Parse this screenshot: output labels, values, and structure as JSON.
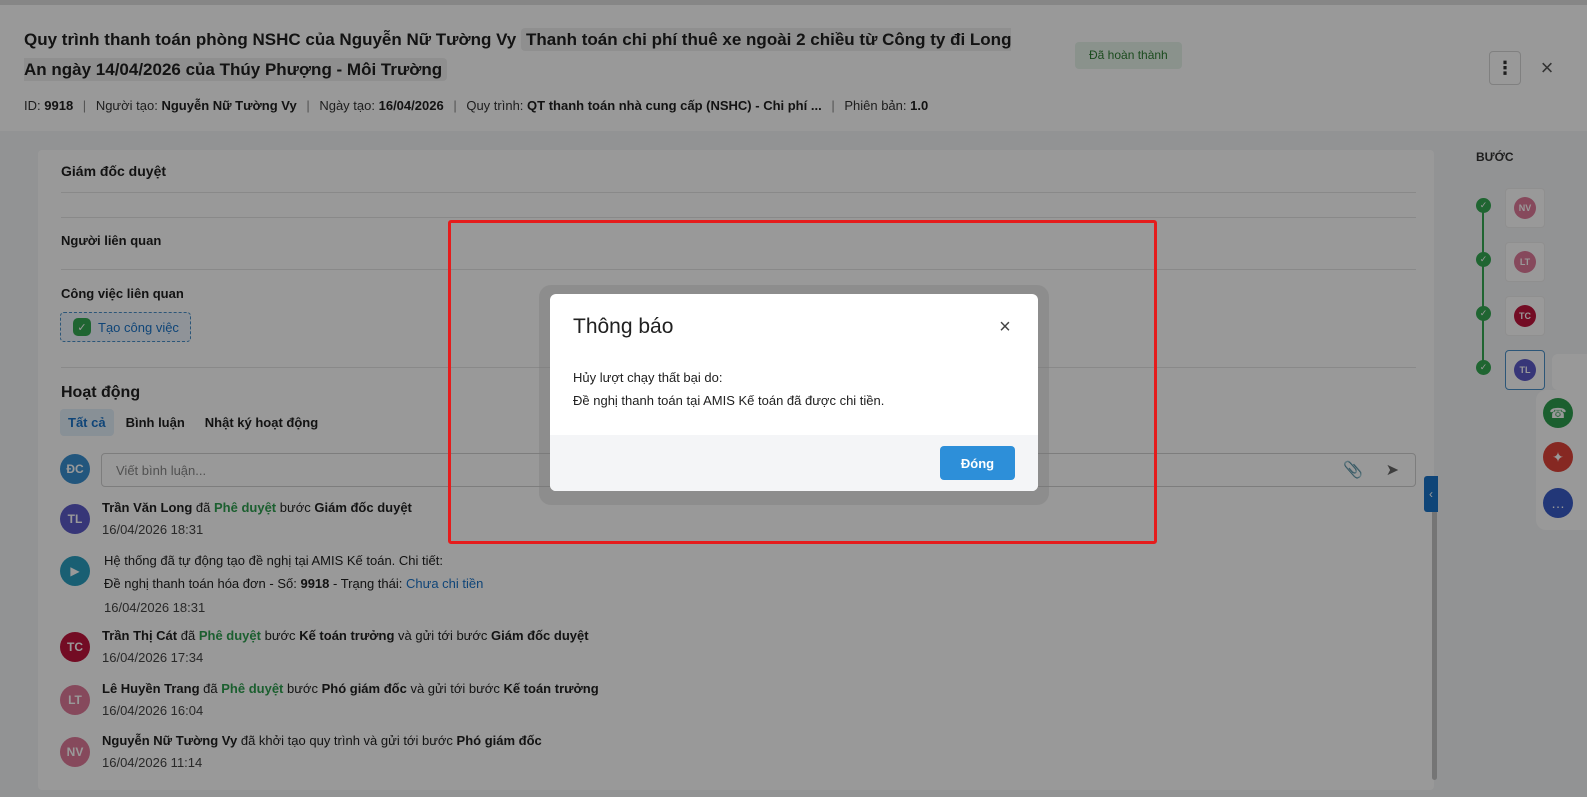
{
  "header": {
    "title_main": "Quy trình thanh toán phòng NSHC của Nguyễn Nữ Tường Vy",
    "title_sub": "Thanh toán chi phí thuê xe ngoài 2 chiều từ Công ty đi Long An ngày 14/04/2026 của Thúy Phượng - Môi Trường",
    "status": "Đã hoàn thành",
    "meta": {
      "id_label": "ID:",
      "id_value": "9918",
      "creator_label": "Người tạo:",
      "creator_value": "Nguyễn Nữ Tường Vy",
      "date_label": "Ngày tạo:",
      "date_value": "16/04/2026",
      "process_label": "Quy trình:",
      "process_value": "QT thanh toán nhà cung cấp (NSHC) - Chi phí ...",
      "version_label": "Phiên bản:",
      "version_value": "1.0"
    }
  },
  "sections": {
    "approver": "Giám đốc duyệt",
    "related_people": "Người liên quan",
    "related_tasks": "Công việc liên quan",
    "create_task": "Tạo công việc"
  },
  "activity": {
    "title": "Hoạt động",
    "tabs": [
      "Tất cả",
      "Bình luận",
      "Nhật ký hoạt động"
    ],
    "comment_avatar": "ĐC",
    "comment_placeholder": "Viết bình luận...",
    "items": [
      {
        "avatar": "TL",
        "avatar_color": "#5c5bc9",
        "actor": "Trần Văn Long",
        "verb": "đã",
        "action": "Phê duyệt",
        "mid": "bước",
        "step": "Giám đốc duyệt",
        "time": "16/04/2026 18:31"
      },
      {
        "system_line1": "Hệ thống đã tự động tạo đề nghị tại AMIS Kế toán. Chi tiết:",
        "system_line2_prefix": "Đề nghị thanh toán hóa đơn - Số:",
        "system_number": "9918",
        "system_status_label": "- Trạng thái:",
        "system_status": "Chưa chi tiền",
        "time": "16/04/2026 18:31"
      },
      {
        "avatar": "TC",
        "avatar_color": "#c0143c",
        "actor": "Trần Thị Cát",
        "verb": "đã",
        "action": "Phê duyệt",
        "mid": "bước",
        "step": "Kế toán trưởng",
        "suffix": "và gửi tới bước",
        "next_step": "Giám đốc duyệt",
        "time": "16/04/2026 17:34"
      },
      {
        "avatar": "LT",
        "avatar_color": "#e07a9a",
        "actor": "Lê Huyền Trang",
        "verb": "đã",
        "action": "Phê duyệt",
        "mid": "bước",
        "step": "Phó giám đốc",
        "suffix": "và gửi tới bước",
        "next_step": "Kế toán trưởng",
        "time": "16/04/2026 16:04"
      },
      {
        "avatar": "NV",
        "avatar_color": "#e07a9a",
        "actor": "Nguyễn Nữ Tường Vy",
        "text": "đã khởi tạo quy trình và gửi tới bước",
        "next_step": "Phó giám đốc",
        "time": "16/04/2026 11:14"
      }
    ]
  },
  "steps": {
    "title": "BƯỚC",
    "items": [
      {
        "initials": "NV",
        "color": "#e07a9a"
      },
      {
        "initials": "LT",
        "color": "#e07a9a"
      },
      {
        "initials": "TC",
        "color": "#c0143c"
      },
      {
        "initials": "TL",
        "color": "#5c5bc9"
      }
    ]
  },
  "dialog": {
    "title": "Thông báo",
    "message_line1": "Hủy lượt chạy thất bại do:",
    "message_line2": "Đề nghị thanh toán tại AMIS Kế toán đã được chi tiền.",
    "ok_label": "Đóng"
  },
  "colors": {
    "accent": "#2d8fd9",
    "success": "#34a853",
    "highlight": "#e51c1c"
  }
}
